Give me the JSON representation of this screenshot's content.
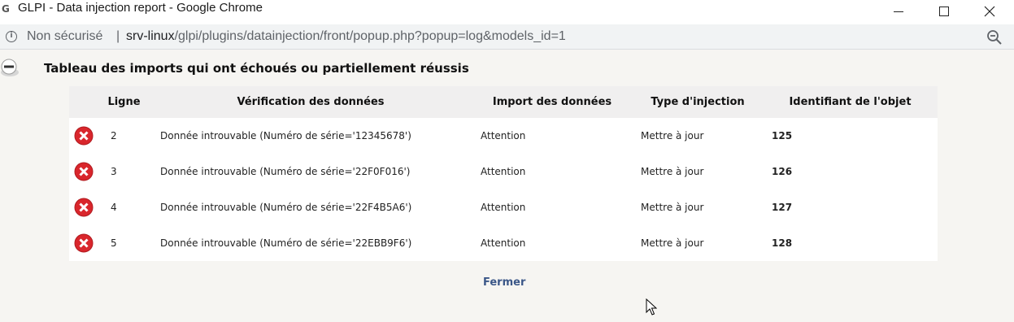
{
  "window": {
    "title": "GLPI - Data injection report - Google Chrome",
    "app_icon_glyph": "G"
  },
  "addressbar": {
    "security_label": "Non sécurisé",
    "separator": "|",
    "url_host": "srv-linux",
    "url_path": "/glpi/plugins/datainjection/front/popup.php?popup=log&models_id=1"
  },
  "page": {
    "title": "Tableau des imports qui ont échoués ou partiellement réussis",
    "close_label": "Fermer"
  },
  "table": {
    "headers": [
      "Ligne",
      "Vérification des données",
      "Import des données",
      "Type d'injection",
      "Identifiant de l'objet"
    ],
    "rows": [
      {
        "line": "2",
        "verification": "Donnée introuvable (Numéro de série='12345678')",
        "import": "Attention",
        "type": "Mettre à jour",
        "id": "125"
      },
      {
        "line": "3",
        "verification": "Donnée introuvable (Numéro de série='22F0F016')",
        "import": "Attention",
        "type": "Mettre à jour",
        "id": "126"
      },
      {
        "line": "4",
        "verification": "Donnée introuvable (Numéro de série='22F4B5A6')",
        "import": "Attention",
        "type": "Mettre à jour",
        "id": "127"
      },
      {
        "line": "5",
        "verification": "Donnée introuvable (Numéro de série='22EBB9F6')",
        "import": "Attention",
        "type": "Mettre à jour",
        "id": "128"
      }
    ]
  },
  "colors": {
    "link": "#3b5788",
    "error": "#d9262c",
    "header_bg": "#f0efef",
    "page_bg": "#f6f5f2"
  },
  "icons": [
    "glpi-app-icon",
    "minimize-icon",
    "maximize-icon",
    "close-icon",
    "info-icon",
    "zoom-icon",
    "collapse-icon",
    "error-icon",
    "mouse-cursor-icon"
  ]
}
